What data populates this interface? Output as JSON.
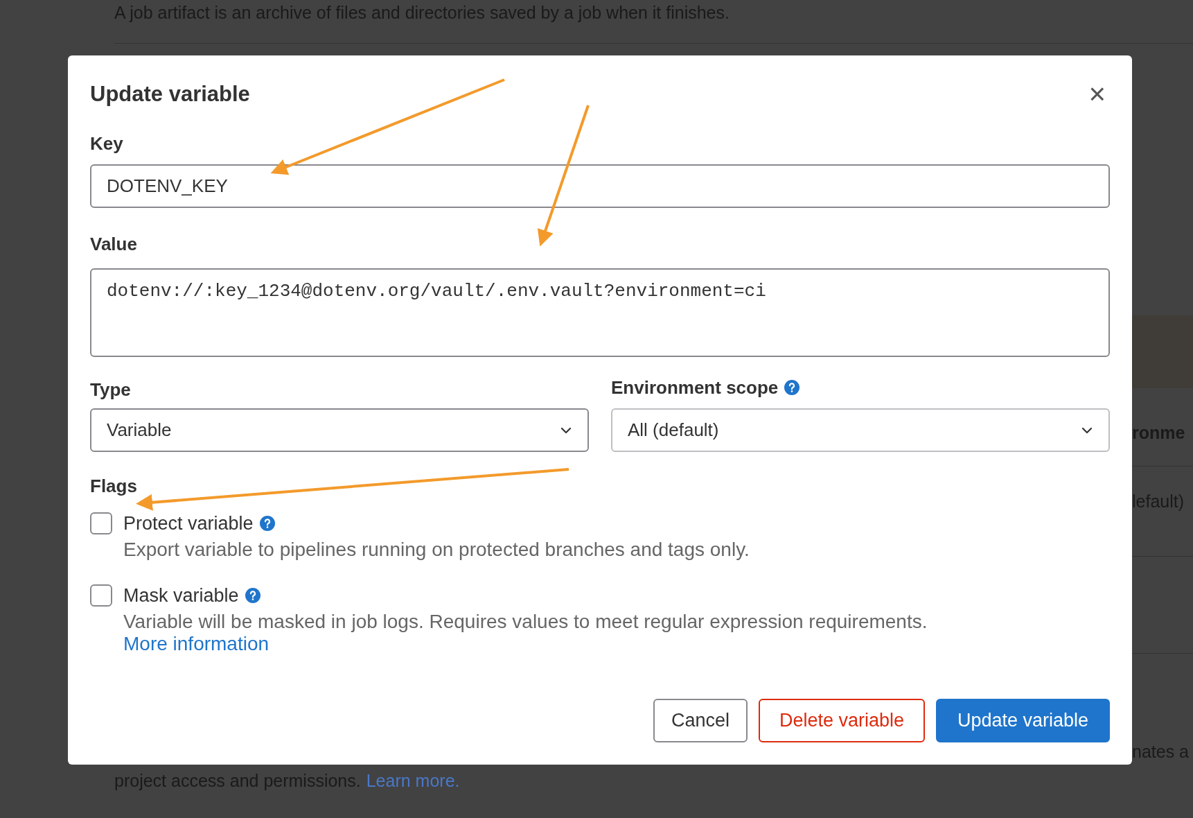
{
  "background": {
    "intro": "A job artifact is an archive of files and directories saved by a job when it finishes.",
    "column_heading": "ronme",
    "cell": "lefault)",
    "side_text": "nates a",
    "footer_text": "project access and permissions.",
    "footer_link": "Learn more."
  },
  "dialog": {
    "title": "Update variable",
    "close": "×",
    "key": {
      "label": "Key",
      "value": "DOTENV_KEY"
    },
    "value": {
      "label": "Value",
      "value": "dotenv://:key_1234@dotenv.org/vault/.env.vault?environment=ci"
    },
    "type": {
      "label": "Type",
      "value": "Variable"
    },
    "scope": {
      "label": "Environment scope",
      "value": "All (default)"
    },
    "flags_label": "Flags",
    "flags": [
      {
        "label": "Protect variable",
        "checked": false,
        "description": "Export variable to pipelines running on protected branches and tags only."
      },
      {
        "label": "Mask variable",
        "checked": false,
        "description": "Variable will be masked in job logs. Requires values to meet regular expression requirements.",
        "link": "More information"
      }
    ],
    "buttons": [
      {
        "label": "Cancel",
        "kind": "secondary"
      },
      {
        "label": "Delete variable",
        "kind": "danger"
      },
      {
        "label": "Update variable",
        "kind": "primary"
      }
    ]
  }
}
